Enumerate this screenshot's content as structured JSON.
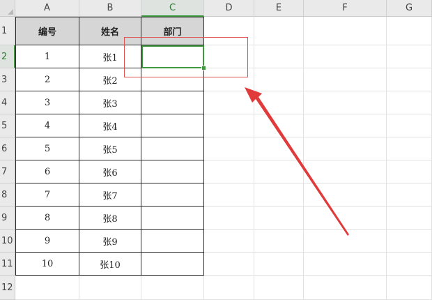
{
  "columns": [
    "A",
    "B",
    "C",
    "D",
    "E",
    "F",
    "G"
  ],
  "rows": [
    "1",
    "2",
    "3",
    "4",
    "5",
    "6",
    "7",
    "8",
    "9",
    "10",
    "11",
    "12"
  ],
  "table": {
    "headers": [
      "编号",
      "姓名",
      "部门"
    ],
    "rows": [
      [
        "1",
        "张1",
        ""
      ],
      [
        "2",
        "张2",
        ""
      ],
      [
        "3",
        "张3",
        ""
      ],
      [
        "4",
        "张4",
        ""
      ],
      [
        "5",
        "张5",
        ""
      ],
      [
        "6",
        "张6",
        ""
      ],
      [
        "7",
        "张7",
        ""
      ],
      [
        "8",
        "张8",
        ""
      ],
      [
        "9",
        "张9",
        ""
      ],
      [
        "10",
        "张10",
        ""
      ]
    ]
  },
  "selection": {
    "cell": "C2"
  },
  "colors": {
    "selection": "#3f9a3f",
    "annotation": "#e03a3a",
    "table_header_bg": "#d6d6d6"
  }
}
